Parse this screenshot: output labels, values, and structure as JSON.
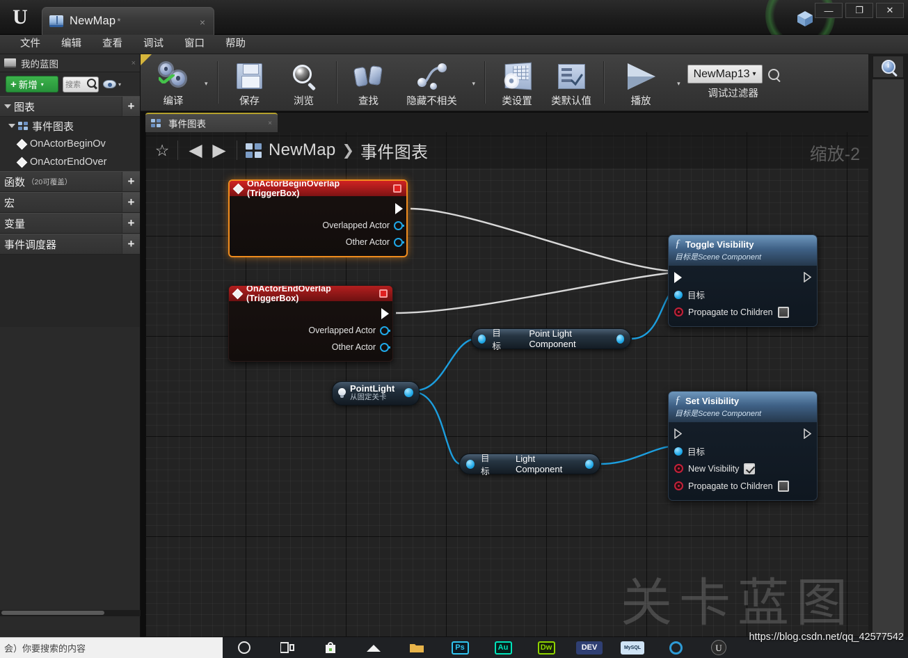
{
  "window": {
    "tab_title": "NewMap",
    "tab_modified_mark": "*",
    "tab_close": "×",
    "minimize": "—",
    "maximize": "❐",
    "close": "✕"
  },
  "menubar": {
    "items": [
      {
        "label": "文件"
      },
      {
        "label": "编辑"
      },
      {
        "label": "查看"
      },
      {
        "label": "调试"
      },
      {
        "label": "窗口"
      },
      {
        "label": "帮助"
      }
    ]
  },
  "my_blueprint": {
    "panel_title": "我的蓝图",
    "close_mark": "×",
    "add_button": {
      "plus": "+",
      "label": "新增",
      "caret": "▾"
    },
    "search_placeholder": "搜索",
    "eye_caret": "▾",
    "sections": [
      {
        "label": "图表",
        "sub": "",
        "add": "+"
      },
      {
        "label": "函数",
        "sub": "（20可覆盖）",
        "add": "+"
      },
      {
        "label": "宏",
        "sub": "",
        "add": "+"
      },
      {
        "label": "变量",
        "sub": "",
        "add": "+"
      },
      {
        "label": "事件调度器",
        "sub": "",
        "add": "+"
      }
    ],
    "event_graph_label": "事件图表",
    "events": [
      {
        "label": "OnActorBeginOv"
      },
      {
        "label": "OnActorEndOver"
      }
    ]
  },
  "toolbar": {
    "compile_label": "编译",
    "compile_caret": "▾",
    "save_label": "保存",
    "browse_label": "浏览",
    "find_label": "查找",
    "hide_unrelated_label": "隐藏不相关",
    "hide_unrelated_caret": "▾",
    "class_settings_label": "类设置",
    "class_defaults_label": "类默认值",
    "play_label": "播放",
    "play_caret": "▾",
    "debug_filter_value": "NewMap13",
    "debug_filter_caret": "▾",
    "debug_filter_label": "调试过滤器"
  },
  "graph": {
    "tab_label": "事件图表",
    "tab_close": "×",
    "star": "☆",
    "back": "◀",
    "forward": "▶",
    "breadcrumb_root": "NewMap",
    "breadcrumb_sep": "❯",
    "breadcrumb_leaf": "事件图表",
    "zoom_label": "缩放-2",
    "watermark": "关卡蓝图"
  },
  "nodes": {
    "begin_overlap": {
      "title": "OnActorBeginOverlap (TriggerBox)",
      "pins": [
        {
          "label": "Overlapped Actor",
          "type": "object"
        },
        {
          "label": "Other Actor",
          "type": "object"
        }
      ],
      "selected": true
    },
    "end_overlap": {
      "title": "OnActorEndOverlap (TriggerBox)",
      "pins": [
        {
          "label": "Overlapped Actor",
          "type": "object"
        },
        {
          "label": "Other Actor",
          "type": "object"
        }
      ],
      "selected": false
    },
    "toggle_visibility": {
      "title": "Toggle Visibility",
      "subtitle": "目标是Scene Component",
      "target_label": "目标",
      "propagate_label": "Propagate to Children",
      "propagate_checked": false
    },
    "set_visibility": {
      "title": "Set Visibility",
      "subtitle": "目标是Scene Component",
      "target_label": "目标",
      "new_visibility_label": "New Visibility",
      "new_visibility_checked": true,
      "propagate_label": "Propagate to Children",
      "propagate_checked": false
    },
    "point_light_component": {
      "target_label": "目标",
      "name": "Point Light Component"
    },
    "light_component": {
      "target_label": "目标",
      "name": "Light Component"
    },
    "point_light_var": {
      "name": "PointLight",
      "subtitle": "从固定关卡"
    }
  },
  "statusbar": {
    "text": "会）你要搜索的内容"
  },
  "taskbar": {
    "items": [
      {
        "name": "search-icon",
        "glyph": "○",
        "color": "#e8e8e8"
      },
      {
        "name": "taskview-icon",
        "glyph": "❏",
        "color": "#e8e8e8"
      },
      {
        "name": "store-icon",
        "glyph": "▯",
        "color": "#e8e8e8"
      },
      {
        "name": "mail-icon",
        "glyph": "✉",
        "color": "#e8e8e8"
      },
      {
        "name": "folder-icon",
        "glyph": "▬",
        "color": "#e8b44a"
      },
      {
        "name": "photoshop-icon",
        "glyph": "Ps",
        "color": "#31c5f0"
      },
      {
        "name": "audition-icon",
        "glyph": "Au",
        "color": "#00e4bb"
      },
      {
        "name": "dreamweaver-icon",
        "glyph": "Dw",
        "color": "#8fd400"
      },
      {
        "name": "dev-icon",
        "glyph": "DEV",
        "color": "#ffffff"
      },
      {
        "name": "mysql-icon",
        "glyph": "MySQL",
        "color": "#cfe3f5"
      },
      {
        "name": "cortana-icon",
        "glyph": "",
        "color": "#2e9bd6"
      },
      {
        "name": "unreal-icon",
        "glyph": "U",
        "color": "#f0f0f0"
      }
    ]
  },
  "url_watermark": "https://blog.csdn.net/qq_42577542"
}
